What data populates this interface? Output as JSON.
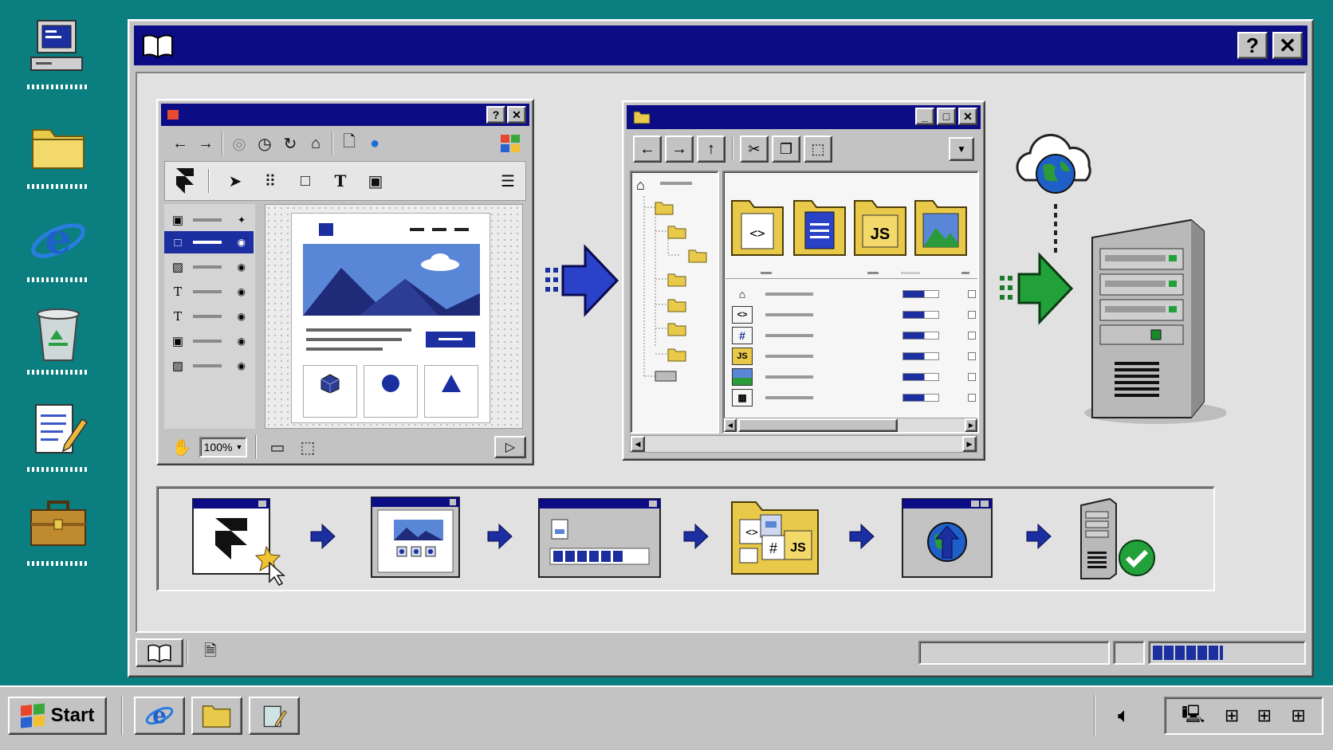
{
  "desktop": {
    "icons": [
      {
        "name": "my-computer-icon"
      },
      {
        "name": "folder-icon"
      },
      {
        "name": "internet-explorer-icon"
      },
      {
        "name": "recycle-bin-icon"
      },
      {
        "name": "notepad-icon"
      },
      {
        "name": "briefcase-icon"
      }
    ]
  },
  "main_window": {
    "title_icon": "book-icon",
    "help_label": "?",
    "close_label": "✕"
  },
  "design_app": {
    "zoom": "100%",
    "title_buttons": [
      "?",
      "✕"
    ]
  },
  "explorer": {
    "title_buttons": [
      "_",
      "□",
      "✕"
    ],
    "folders": [
      "code-file-folder",
      "document-folder",
      "JS",
      "image-folder"
    ],
    "file_rows": [
      "home-icon",
      "<>",
      "#",
      "JS",
      "image-icon",
      "table-icon"
    ]
  },
  "pipeline": {
    "steps": [
      "design-tool",
      "layout-mockup",
      "export-progress",
      "source-files",
      "upload",
      "server-ok"
    ],
    "js_label": "JS",
    "hash_label": "#"
  },
  "taskbar": {
    "start_label": "Start"
  },
  "colors": {
    "desktop": "#0b7f7f",
    "titlebar": "#0c0c84",
    "window": "#c3c3c3",
    "accent_blue": "#1b2fa0",
    "accent_green": "#22a03a",
    "folder_yellow": "#e9c94a"
  }
}
